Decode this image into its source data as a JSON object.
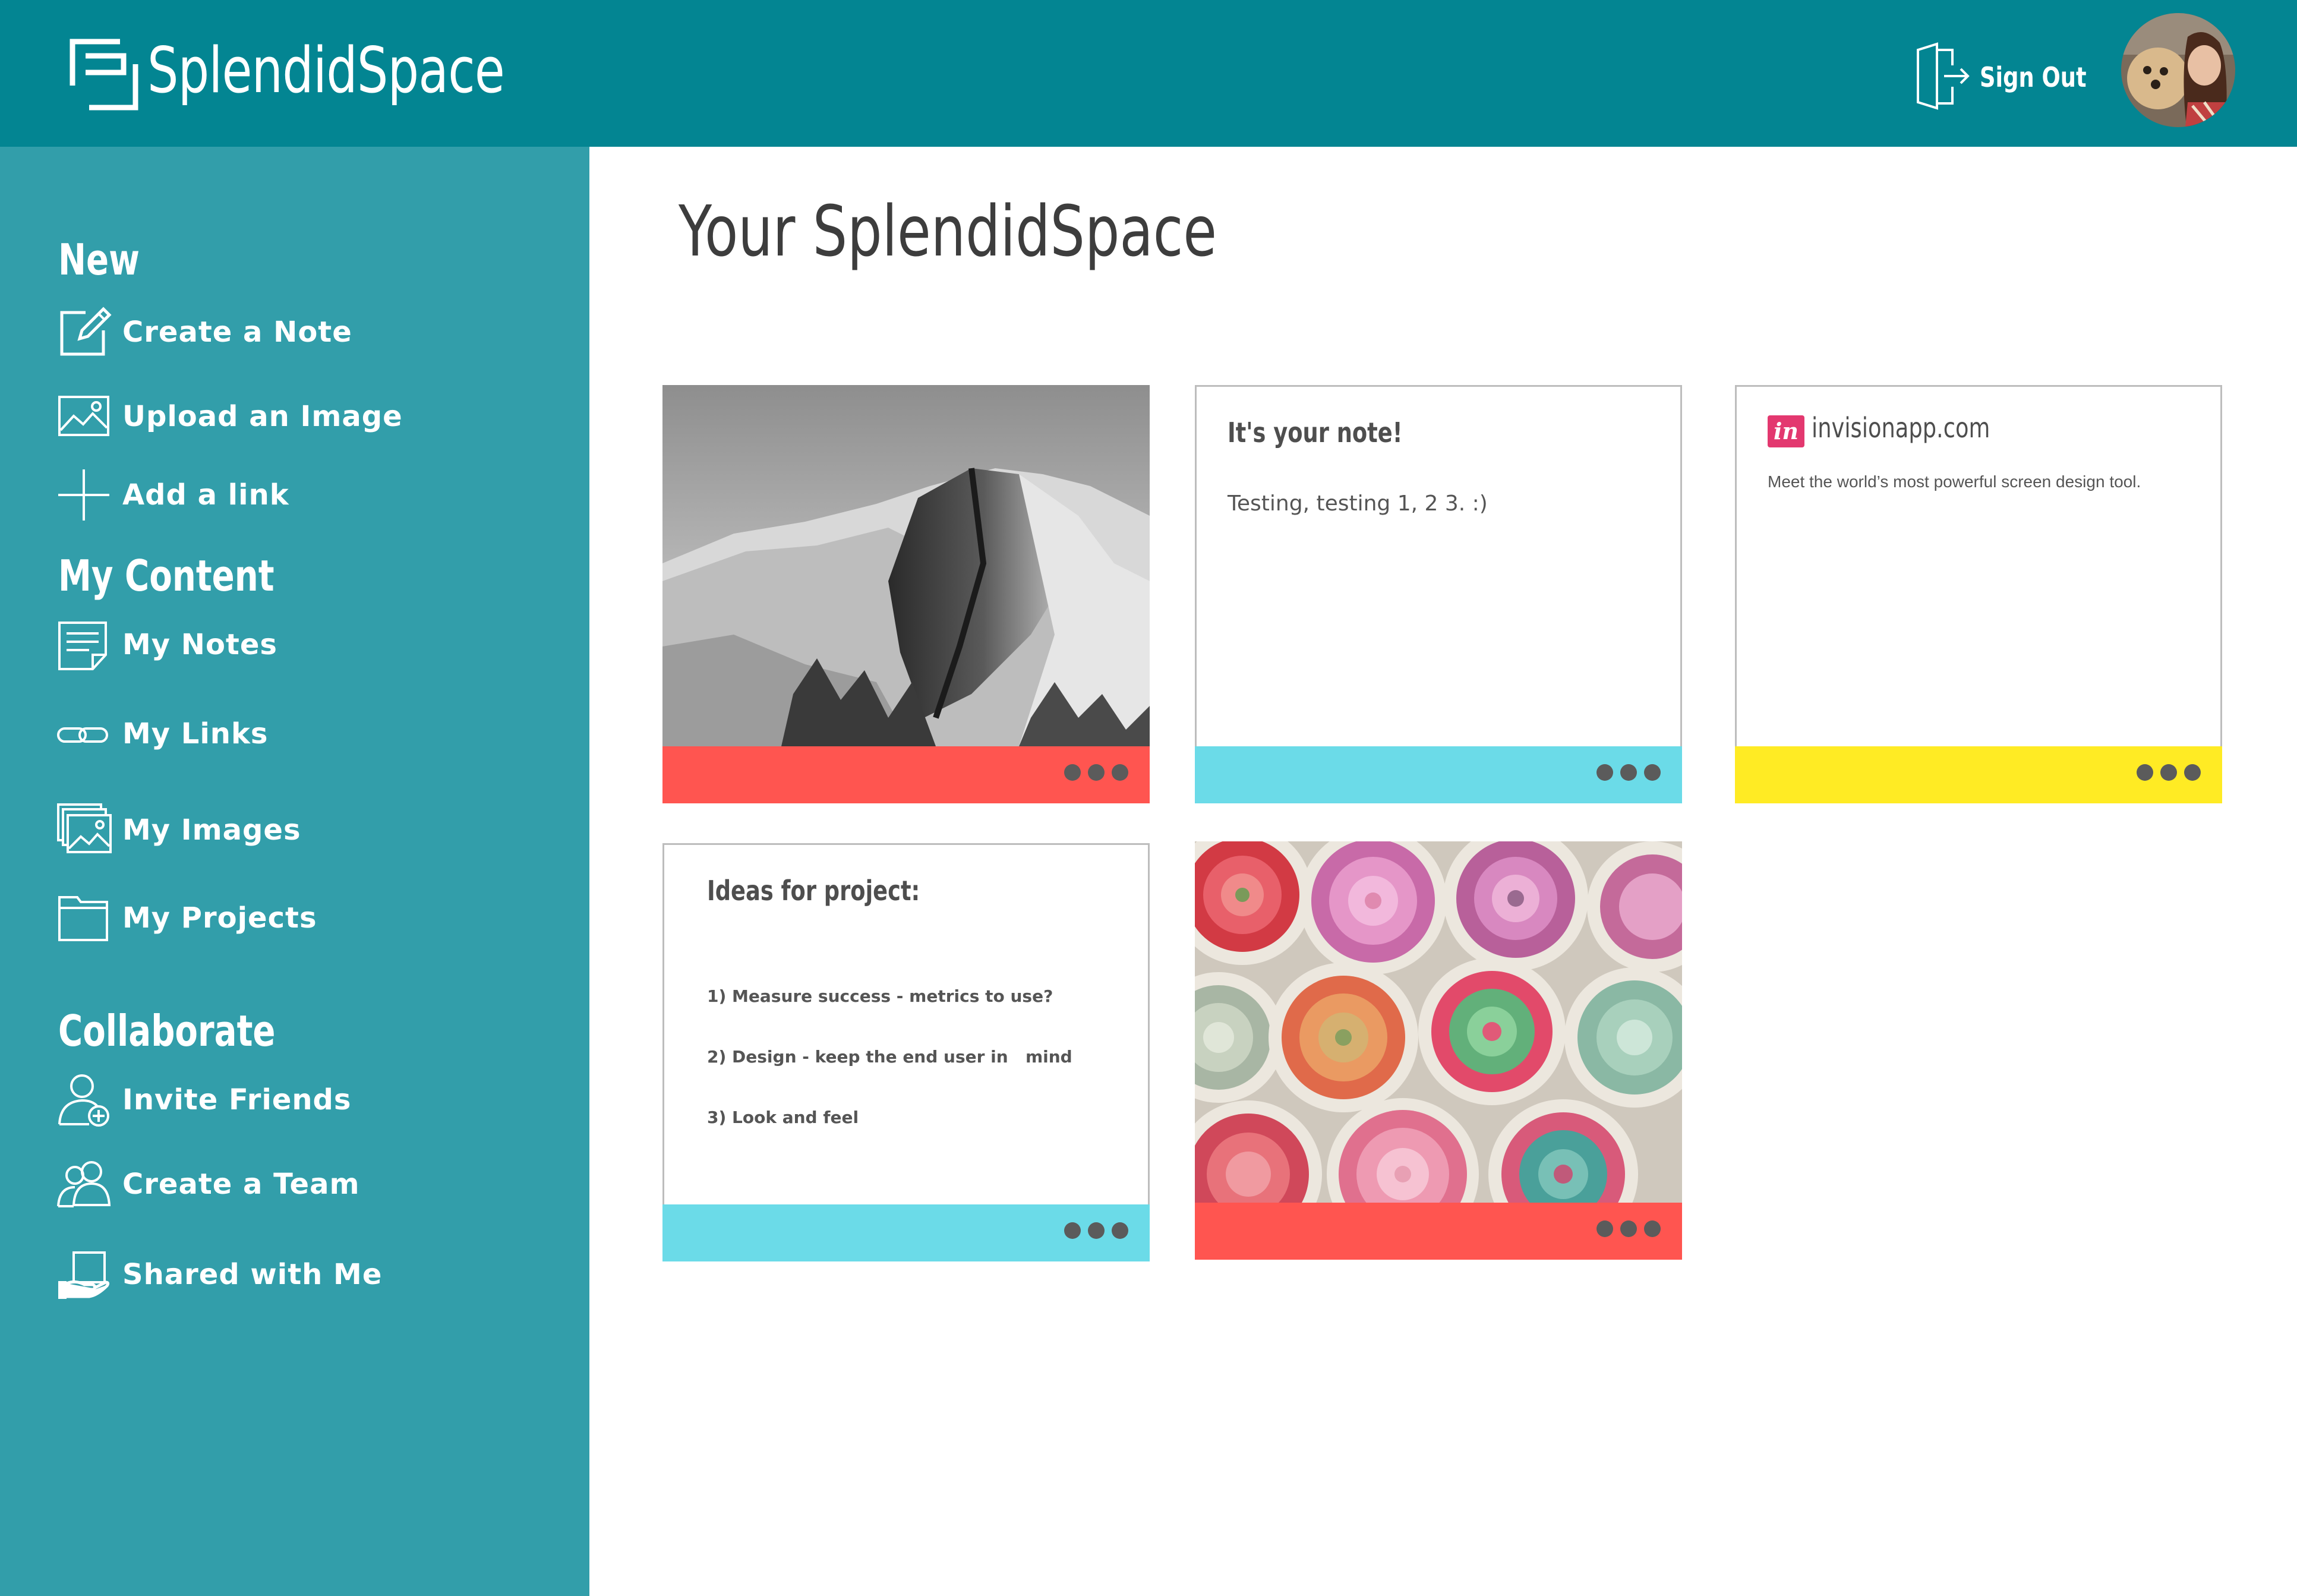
{
  "header": {
    "app_name": "SplendidSpace",
    "signout_label": "Sign Out",
    "logo_icon": "logo-bracket-icon",
    "signout_icon": "door-exit-icon"
  },
  "sidebar": {
    "sections": [
      {
        "heading": "New",
        "items": [
          {
            "label": "Create a Note",
            "icon": "edit-note-icon"
          },
          {
            "label": "Upload an Image",
            "icon": "image-upload-icon"
          },
          {
            "label": "Add a link",
            "icon": "plus-icon"
          }
        ]
      },
      {
        "heading": "My Content",
        "items": [
          {
            "label": "My Notes",
            "icon": "notes-icon"
          },
          {
            "label": "My Links",
            "icon": "link-icon"
          },
          {
            "label": "My Images",
            "icon": "images-icon"
          },
          {
            "label": "My Projects",
            "icon": "folder-icon"
          }
        ]
      },
      {
        "heading": "Collaborate",
        "items": [
          {
            "label": "Invite Friends",
            "icon": "add-user-icon"
          },
          {
            "label": "Create a Team",
            "icon": "team-icon"
          },
          {
            "label": "Shared with Me",
            "icon": "shared-hand-icon"
          }
        ]
      }
    ]
  },
  "main": {
    "title": "Your SplendidSpace",
    "cards": [
      {
        "type": "image",
        "image": "mountain-photo",
        "footer_color": "#FF5550"
      },
      {
        "type": "note",
        "title": "It's your note!",
        "text": "Testing, testing 1, 2 3. :)",
        "footer_color": "#6BDBE8"
      },
      {
        "type": "link",
        "badge": "in",
        "domain": "invisionapp.com",
        "description": "Meet the world’s most powerful screen design tool.",
        "footer_color": "#FFEB24"
      },
      {
        "type": "note",
        "title": "Ideas for project:",
        "lines": [
          "1) Measure success - metrics to use?",
          "2) Design - keep the end user in   mind",
          "3) Look and feel"
        ],
        "footer_color": "#6BDBE8"
      },
      {
        "type": "image",
        "image": "succulents-photo",
        "footer_color": "#FF5550"
      }
    ]
  },
  "colors": {
    "header": "#038592",
    "sidebar": "#329EAA",
    "accent_red": "#FF5550",
    "accent_cyan": "#6BDBE8",
    "accent_yellow": "#FFEB24"
  }
}
